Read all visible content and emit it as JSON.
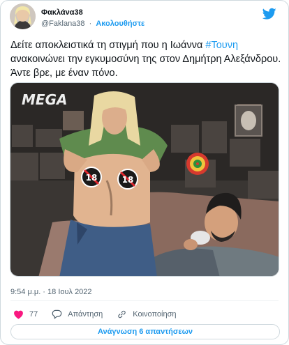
{
  "tweet": {
    "author_name": "Φακλάνα38",
    "handle": "@Faklana38",
    "separator": "·",
    "follow_label": "Ακολουθήστε",
    "text_before_hashtag": "Δείτε αποκλειστικά τη στιγμή που η Ιωάννα ",
    "hashtag": "#Τουνη",
    "text_after_hashtag": " ανακοινώνει την εγκυμοσύνη της στον Δημήτρη Αλεξάνδρου. Άντε βρε, με έναν πόνο.",
    "timestamp": "9:54 μ.μ. · 18 Ιουλ 2022",
    "likes": "77",
    "reply_label": "Απάντηση",
    "share_label": "Κοινοποίηση",
    "read_replies_label": "Ανάγνωση 6 απαντήσεων"
  },
  "media": {
    "channel_logo_text": "MEGA",
    "censor_badge_text": "18"
  },
  "colors": {
    "accent": "#1d9bf0",
    "like": "#f91880",
    "secondary_text": "#536471"
  }
}
